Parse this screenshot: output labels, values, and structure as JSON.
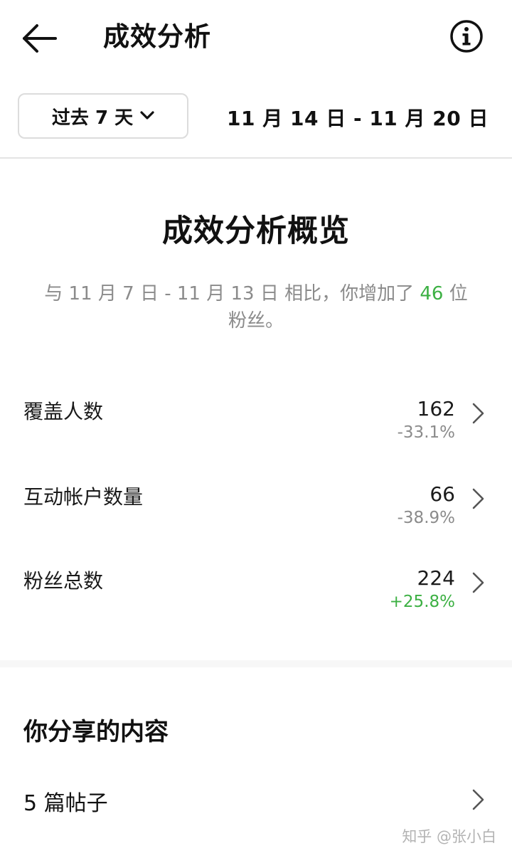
{
  "header": {
    "title": "成效分析",
    "back_icon": "arrow-left-icon",
    "info_icon": "info-circle-icon"
  },
  "range": {
    "selected": "过去 7 天",
    "date_range": "11 月 14 日 - 11 月 20 日"
  },
  "overview": {
    "title": "成效分析概览",
    "summary_prefix": "与 11 月 7 日 - 11 月 13 日 相比，你增加了 ",
    "summary_highlight": "46",
    "summary_suffix": " 位粉丝。"
  },
  "metrics": [
    {
      "label": "覆盖人数",
      "value": "162",
      "change": "-33.1%",
      "trend": "down"
    },
    {
      "label": "互动帐户数量",
      "value": "66",
      "change": "-38.9%",
      "trend": "down"
    },
    {
      "label": "粉丝总数",
      "value": "224",
      "change": "+25.8%",
      "trend": "up"
    }
  ],
  "shared": {
    "title": "你分享的内容",
    "posts_label": "5 篇帖子"
  },
  "watermark": "知乎 @张小白",
  "colors": {
    "positive": "#3cb043",
    "muted": "#8b8b8b",
    "text": "#111111",
    "divider": "#e4e4e4"
  }
}
